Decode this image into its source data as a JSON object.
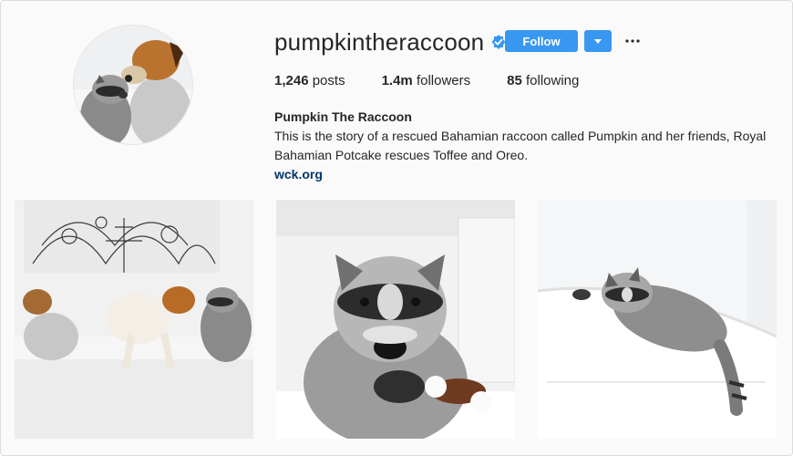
{
  "profile": {
    "username": "pumpkintheraccoon",
    "verified_icon": "verified-badge-icon",
    "follow_label": "Follow",
    "dropdown_icon": "caret-down-icon",
    "more_icon": "more-options-icon"
  },
  "stats": {
    "posts_count": "1,246",
    "posts_label": " posts",
    "followers_count": "1.4m",
    "followers_label": " followers",
    "following_count": "85",
    "following_label": " following"
  },
  "bio": {
    "full_name": "Pumpkin The Raccoon",
    "text": "This is the story of a rescued Bahamian raccoon called Pumpkin and her friends, Royal Bahamian Potcake rescues Toffee and Oreo.",
    "link": "wck.org"
  },
  "colors": {
    "accent": "#3897f0",
    "link": "#003569",
    "verified": "#3897f0"
  }
}
